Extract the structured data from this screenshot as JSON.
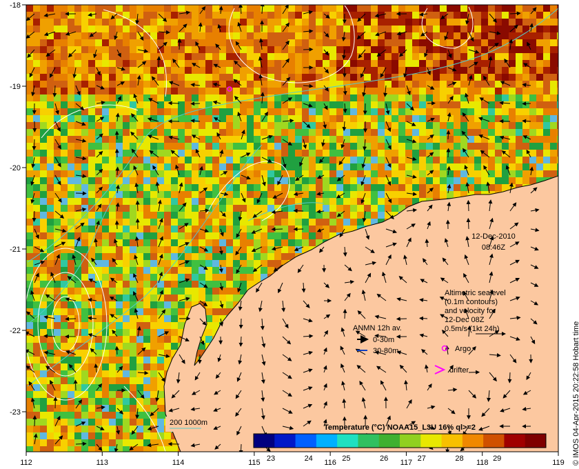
{
  "map": {
    "lon_ticks": [
      "112",
      "113",
      "114",
      "115",
      "116",
      "117",
      "118",
      "119"
    ],
    "lat_ticks": [
      "-18",
      "-19",
      "-20",
      "-21",
      "-22",
      "-23"
    ],
    "date_line": "12-Dec-2010",
    "time_line": "08:46Z",
    "credit": "© IMOS 04-Apr-2015 20:22:58 Hobart time",
    "land_color": "#fcc8a0",
    "coast_color": "#000000",
    "contour_color": "#ffffff",
    "isobath_color": "#55cccc",
    "argo_color": "#ff00ff"
  },
  "legend": {
    "altimetry": [
      "Altimetric sealevel",
      "(0.1m contours)",
      "and velocity for",
      "12-Dec 08Z",
      "0.5m/s (1kt 24h)"
    ],
    "anmn_title": "ANMN 12h av.",
    "anmn_items": [
      {
        "label": "0-30m",
        "color": "#000000"
      },
      {
        "label": "30-80m",
        "color": "#1040c0"
      }
    ],
    "argo_label": "Argo",
    "drifter_label": "drifter",
    "isobath_label": "200  1000m"
  },
  "colorbar": {
    "title": "Temperature (°C) NOAA15_L3U 16% ql>=2",
    "ticks": [
      "23",
      "24",
      "25",
      "26",
      "27",
      "28",
      "29"
    ],
    "colors": [
      "#00007f",
      "#0018c8",
      "#0060ff",
      "#00b0ff",
      "#20e0c0",
      "#30c060",
      "#40b030",
      "#90d020",
      "#e8e800",
      "#f8c000",
      "#f08800",
      "#d05000",
      "#a00000",
      "#7f0000"
    ]
  }
}
